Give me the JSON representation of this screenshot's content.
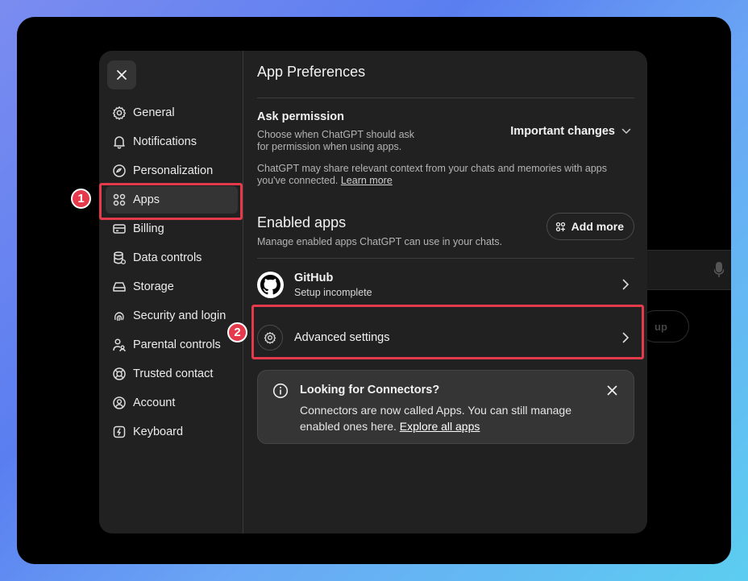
{
  "sidebar": {
    "items": [
      {
        "label": "General",
        "icon": "gear-icon"
      },
      {
        "label": "Notifications",
        "icon": "bell-icon"
      },
      {
        "label": "Personalization",
        "icon": "personalization-icon"
      },
      {
        "label": "Apps",
        "icon": "apps-grid-icon",
        "active": true
      },
      {
        "label": "Billing",
        "icon": "credit-card-icon"
      },
      {
        "label": "Data controls",
        "icon": "database-icon"
      },
      {
        "label": "Storage",
        "icon": "storage-icon"
      },
      {
        "label": "Security and login",
        "icon": "fingerprint-icon"
      },
      {
        "label": "Parental controls",
        "icon": "parental-icon"
      },
      {
        "label": "Trusted contact",
        "icon": "lifebuoy-icon"
      },
      {
        "label": "Account",
        "icon": "account-icon"
      },
      {
        "label": "Keyboard",
        "icon": "keyboard-icon"
      }
    ]
  },
  "main": {
    "title": "App Preferences",
    "ask_permission": {
      "label": "Ask permission",
      "desc_line1": "Choose when ChatGPT should ask",
      "desc_line2": "for permission when using apps.",
      "value": "Important changes"
    },
    "context_note": {
      "line1": "ChatGPT may share relevant context from your chats and memories with apps",
      "line2_prefix": "you've connected. ",
      "link": "Learn more"
    },
    "enabled_apps": {
      "title": "Enabled apps",
      "desc": "Manage enabled apps ChatGPT can use in your chats.",
      "add_more": "Add more"
    },
    "apps": [
      {
        "name": "GitHub",
        "status": "Setup incomplete"
      }
    ],
    "advanced_settings": "Advanced settings",
    "notice": {
      "title": "Looking for Connectors?",
      "line1": "Connectors are now called Apps. You can still manage",
      "line2_prefix": "enabled ones here. ",
      "link": "Explore all apps"
    }
  },
  "annotations": {
    "badge1": "1",
    "badge2": "2",
    "highlight_color": "#e53a4b"
  },
  "background": {
    "pill_text": "up"
  }
}
